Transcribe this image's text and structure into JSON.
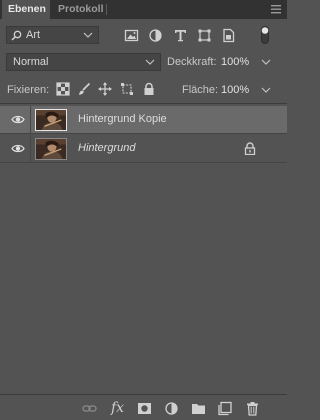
{
  "tabs": [
    {
      "label": "Ebenen",
      "active": true
    },
    {
      "label": "Protokoll",
      "active": false
    }
  ],
  "filter": {
    "kind_label": "Art",
    "icons": [
      "image-filter-icon",
      "adjustment-filter-icon",
      "type-filter-icon",
      "shape-filter-icon",
      "smart-object-filter-icon"
    ]
  },
  "blend": {
    "mode": "Normal",
    "opacity_label": "Deckkraft:",
    "opacity_value": "100%"
  },
  "lock": {
    "label": "Fixieren:",
    "fill_label": "Fläche:",
    "fill_value": "100%",
    "icons": [
      "lock-transparent-pixels-icon",
      "lock-image-pixels-icon",
      "lock-position-icon",
      "prevent-autonest-icon",
      "lock-all-icon"
    ]
  },
  "layers": [
    {
      "name": "Hintergrund Kopie",
      "selected": true,
      "visible": true,
      "locked": false,
      "italic": false
    },
    {
      "name": "Hintergrund",
      "selected": false,
      "visible": true,
      "locked": true,
      "italic": true
    }
  ],
  "bottom_toolbar": {
    "fx_label": "fx",
    "icons": [
      "link-layers-icon",
      "layer-style-icon",
      "layer-mask-icon",
      "adjustment-layer-icon",
      "new-group-icon",
      "new-layer-icon",
      "delete-layer-icon"
    ]
  },
  "colors": {
    "panel_bg": "#535353",
    "tab_bar_bg": "#323232",
    "selected_layer_bg": "#6a6a6a"
  }
}
